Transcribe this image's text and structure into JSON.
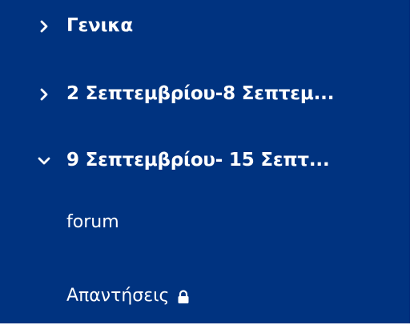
{
  "sections": [
    {
      "label": "Γενικα",
      "icon": "chevron-right-icon",
      "expanded": false
    },
    {
      "label": "2 Σεπτεμβρίου-8 Σεπτεμ...",
      "icon": "chevron-right-icon",
      "expanded": false
    },
    {
      "label": "9 Σεπτεμβρίου- 15 Σεπτ...",
      "icon": "chevron-down-icon",
      "expanded": true
    }
  ],
  "activities": [
    {
      "label": "forum",
      "locked": false
    },
    {
      "label": "Απαντήσεις",
      "locked": true,
      "icon": "lock-icon"
    }
  ],
  "colors": {
    "panel_background": "#003380",
    "text": "#ffffff",
    "outer_background": "#ffffff"
  }
}
